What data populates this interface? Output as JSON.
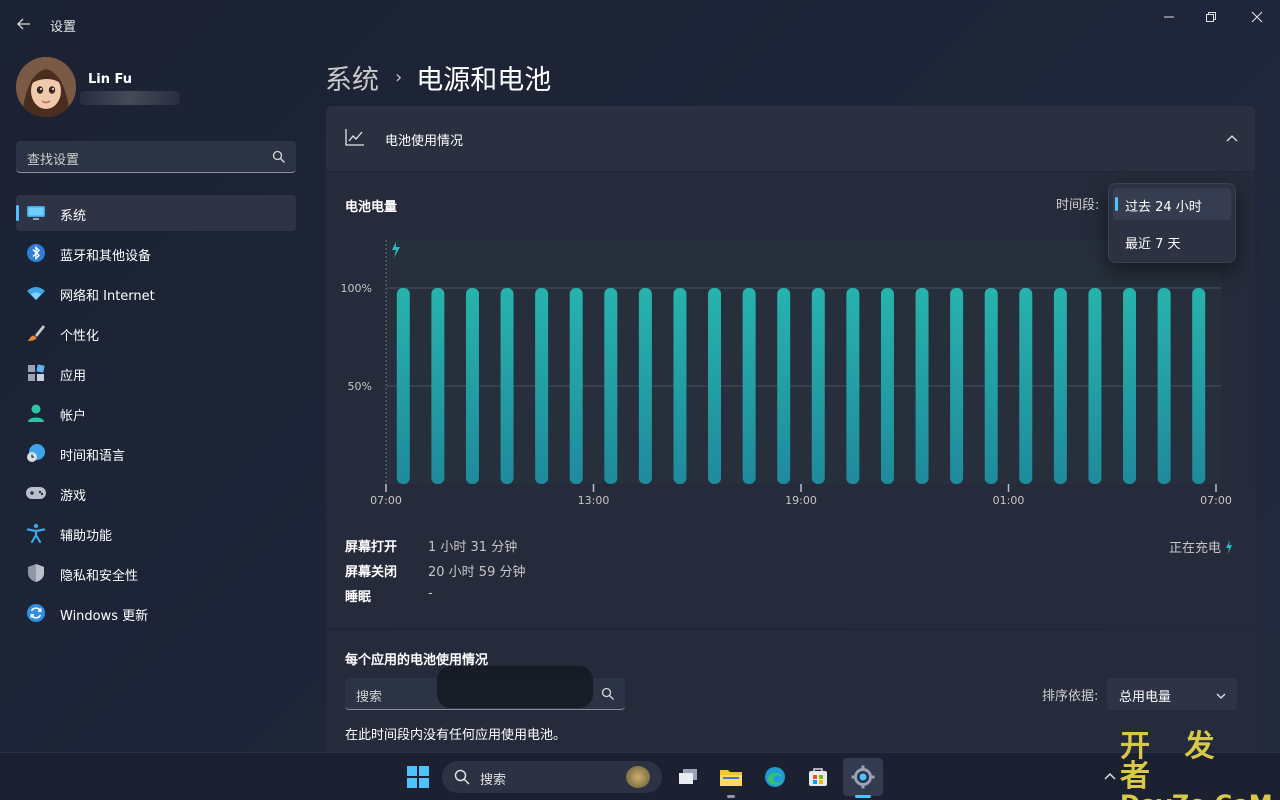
{
  "app": {
    "title": "设置"
  },
  "user": {
    "name": "Lin Fu"
  },
  "sidebar": {
    "search_placeholder": "查找设置",
    "items": [
      {
        "label": "系统",
        "icon": "monitor-icon",
        "active": true
      },
      {
        "label": "蓝牙和其他设备",
        "icon": "bluetooth-icon"
      },
      {
        "label": "网络和 Internet",
        "icon": "wifi-icon"
      },
      {
        "label": "个性化",
        "icon": "brush-icon"
      },
      {
        "label": "应用",
        "icon": "apps-icon"
      },
      {
        "label": "帐户",
        "icon": "person-icon"
      },
      {
        "label": "时间和语言",
        "icon": "globe-clock-icon"
      },
      {
        "label": "游戏",
        "icon": "gamepad-icon"
      },
      {
        "label": "辅助功能",
        "icon": "accessibility-icon"
      },
      {
        "label": "隐私和安全性",
        "icon": "shield-icon"
      },
      {
        "label": "Windows 更新",
        "icon": "update-icon"
      }
    ]
  },
  "breadcrumb": {
    "parent": "系统",
    "current": "电源和电池"
  },
  "battery_usage": {
    "header": "电池使用情况",
    "chart_title": "电池电量",
    "period_label": "时间段:",
    "period_options": [
      "过去 24 小时",
      "最近 7 天"
    ],
    "selected_period": "过去 24 小时",
    "stats": [
      {
        "label": "屏幕打开",
        "value": "1 小时 31 分钟"
      },
      {
        "label": "屏幕关闭",
        "value": "20 小时 59 分钟"
      },
      {
        "label": "睡眠",
        "value": "-"
      }
    ],
    "charging_status": "正在充电"
  },
  "chart_data": {
    "type": "bar",
    "categories": [
      "07:00",
      "08:00",
      "09:00",
      "10:00",
      "11:00",
      "12:00",
      "13:00",
      "14:00",
      "15:00",
      "16:00",
      "17:00",
      "18:00",
      "19:00",
      "20:00",
      "21:00",
      "22:00",
      "23:00",
      "00:00",
      "01:00",
      "02:00",
      "03:00",
      "04:00",
      "05:00",
      "06:00"
    ],
    "values": [
      100,
      100,
      100,
      100,
      100,
      100,
      100,
      100,
      100,
      100,
      100,
      100,
      100,
      100,
      100,
      100,
      100,
      100,
      100,
      100,
      100,
      100,
      100,
      100
    ],
    "x_tick_labels": [
      "07:00",
      "13:00",
      "19:00",
      "01:00",
      "07:00"
    ],
    "y_tick_labels": [
      "100%",
      "50%"
    ],
    "ylim": [
      0,
      100
    ],
    "grid": true,
    "colors": {
      "bar_top": "#27b3ad",
      "bar_bottom": "#1f8a9c"
    }
  },
  "app_usage": {
    "title": "每个应用的电池使用情况",
    "search_placeholder": "搜索",
    "sort_label": "排序依据:",
    "sort_value": "总用电量",
    "empty_message": "在此时间段内没有任何应用使用电池。"
  },
  "taskbar": {
    "search_label": "搜索"
  },
  "watermark": {
    "line1": "开 发 者",
    "line2": "DevZe.CoM"
  },
  "accent": "#4cc2ff"
}
